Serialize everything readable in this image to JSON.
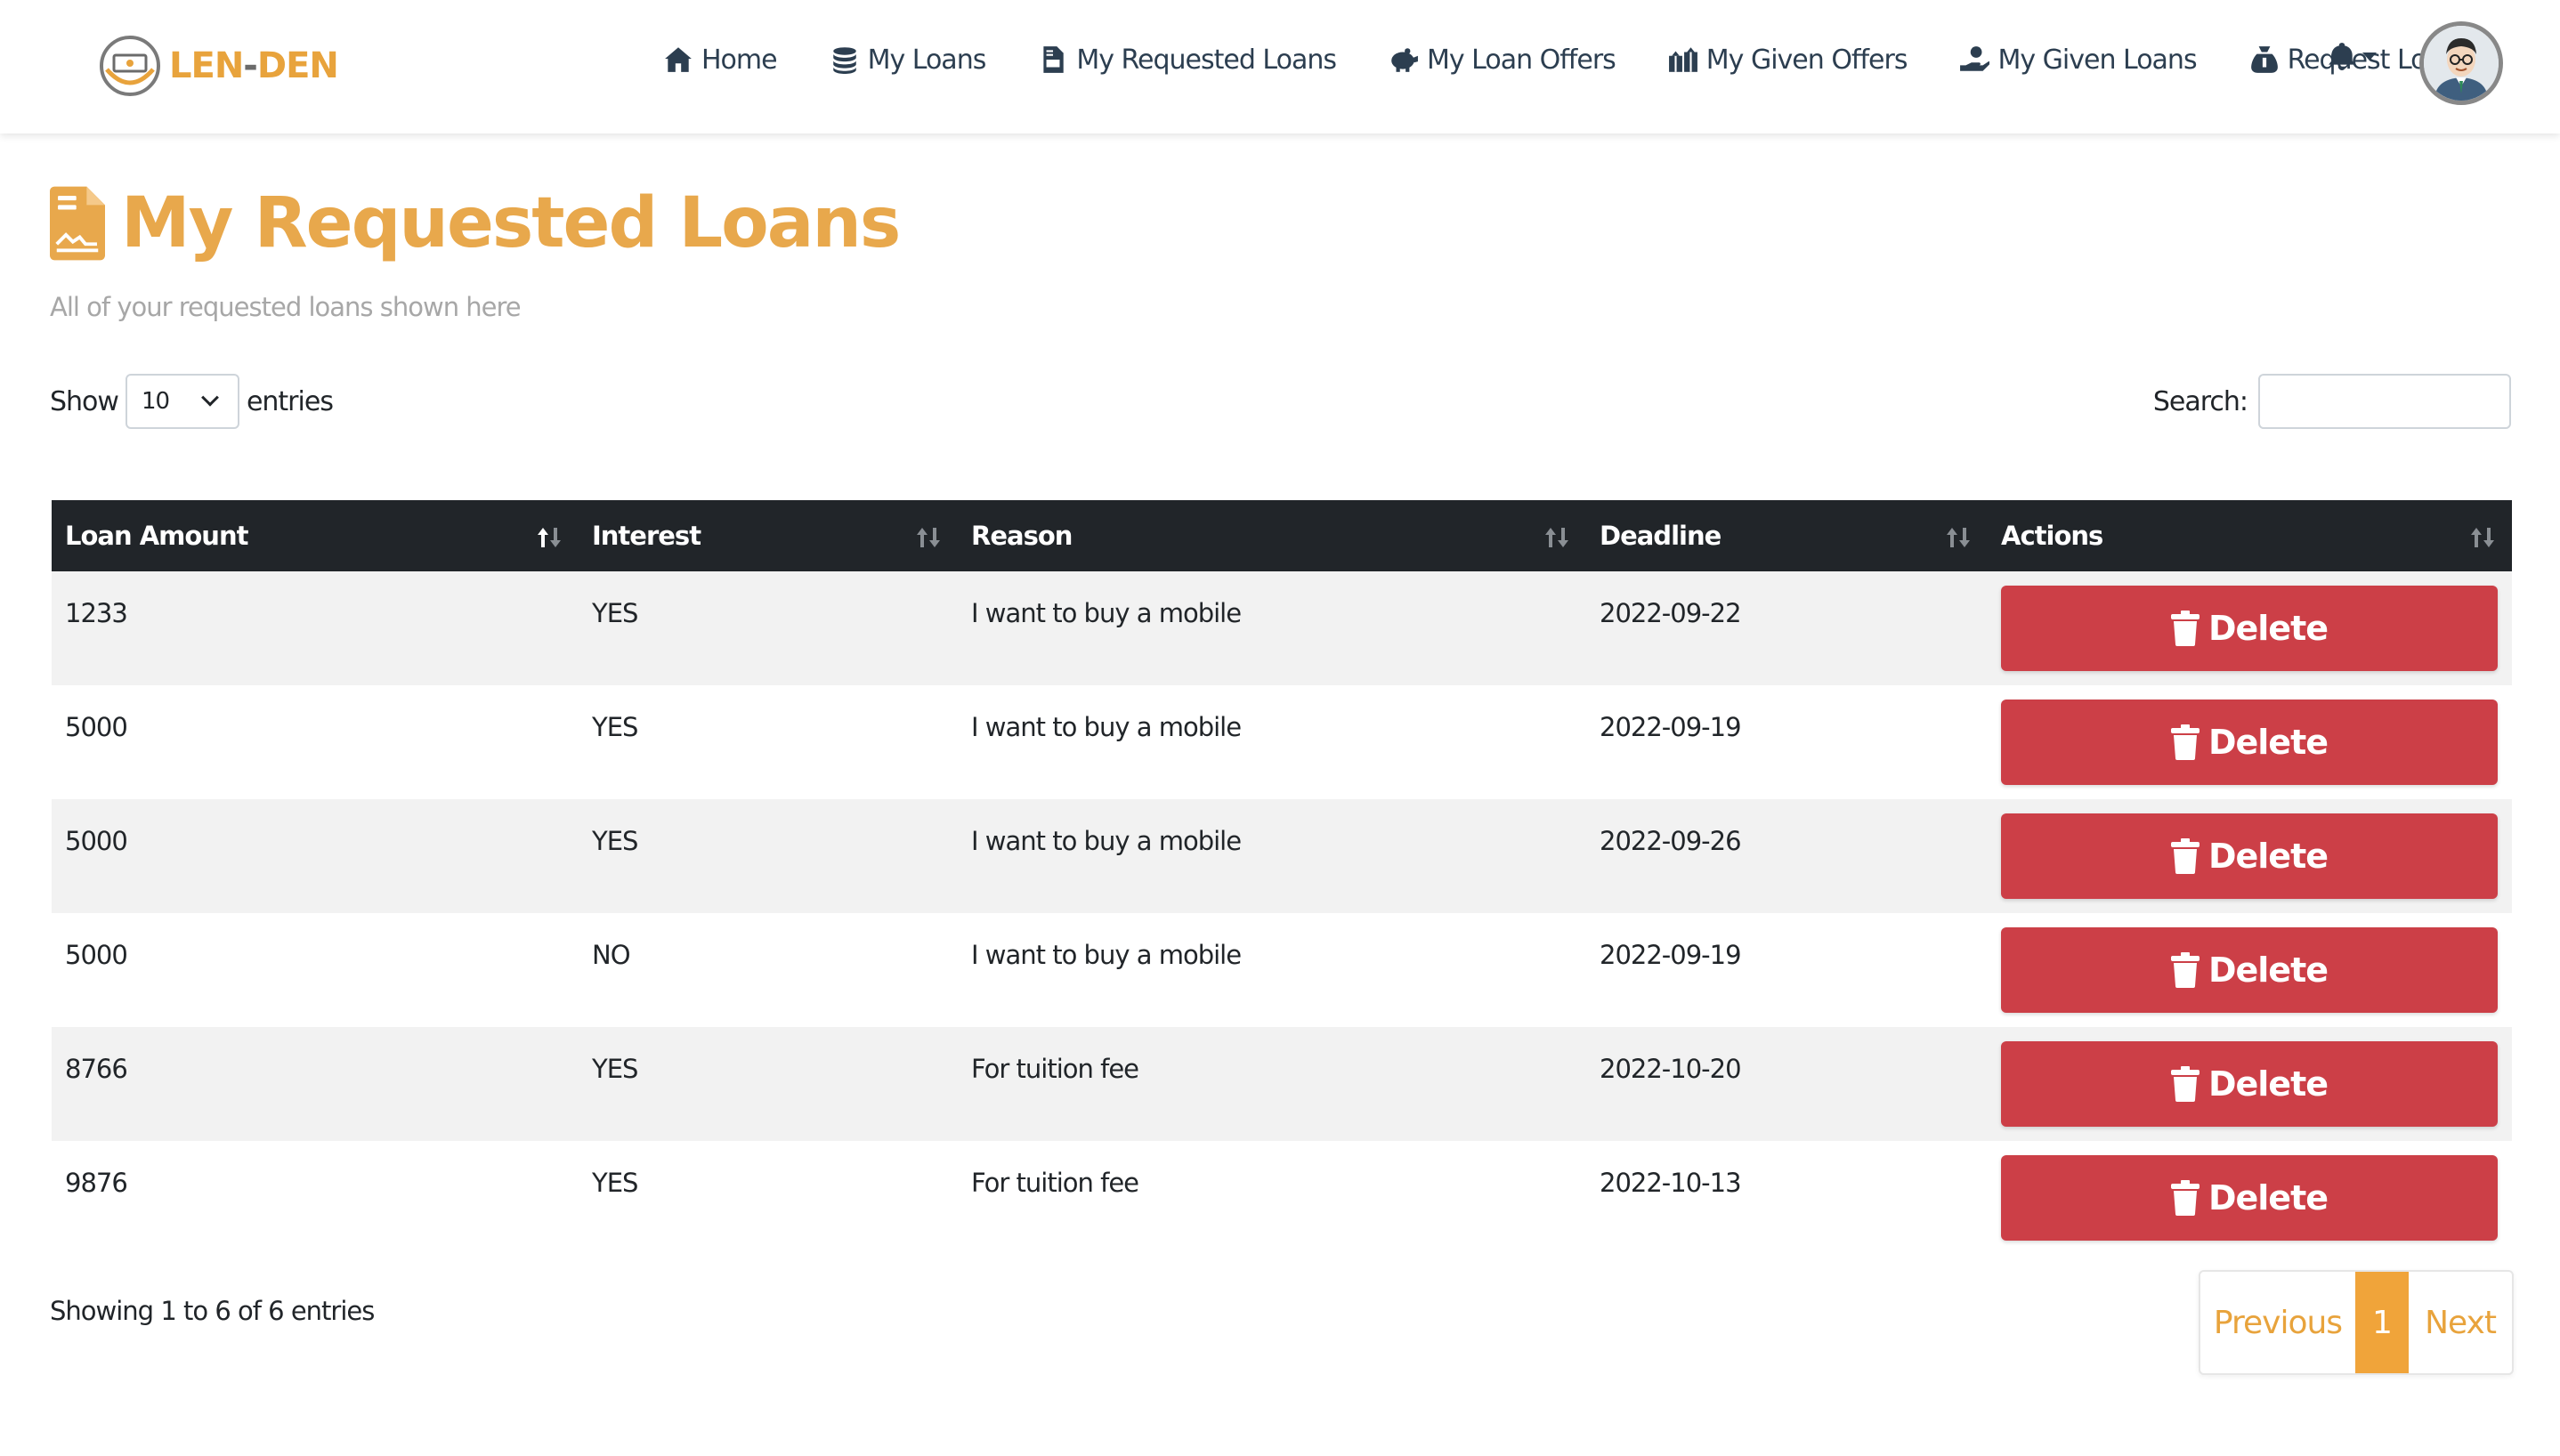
{
  "brand": {
    "name_a": "LEN",
    "name_sep": "-",
    "name_b": "DEN"
  },
  "nav": {
    "items": [
      {
        "label": "Home",
        "icon": "house-icon"
      },
      {
        "label": "My Loans",
        "icon": "coins-icon"
      },
      {
        "label": "My Requested Loans",
        "icon": "file-invoice-icon"
      },
      {
        "label": "My Loan Offers",
        "icon": "piggy-bank-icon"
      },
      {
        "label": "My Given Offers",
        "icon": "gifts-icon"
      },
      {
        "label": "My Given Loans",
        "icon": "hand-holding-dollar-icon"
      },
      {
        "label": "Request Loan",
        "icon": "money-bag-icon"
      }
    ]
  },
  "page": {
    "title": "My Requested Loans",
    "subtitle": "All of your requested loans shown here"
  },
  "controls": {
    "show_label": "Show",
    "entries_value": "10",
    "entries_label": "entries",
    "search_label": "Search:",
    "search_value": ""
  },
  "table": {
    "headers": [
      "Loan Amount",
      "Interest",
      "Reason",
      "Deadline",
      "Actions"
    ],
    "rows": [
      {
        "amount": "1233",
        "interest": "YES",
        "reason": "I want to buy a mobile",
        "deadline": "2022-09-22",
        "action": "Delete"
      },
      {
        "amount": "5000",
        "interest": "YES",
        "reason": "I want to buy a mobile",
        "deadline": "2022-09-19",
        "action": "Delete"
      },
      {
        "amount": "5000",
        "interest": "YES",
        "reason": "I want to buy a mobile",
        "deadline": "2022-09-26",
        "action": "Delete"
      },
      {
        "amount": "5000",
        "interest": "NO",
        "reason": "I want to buy a mobile",
        "deadline": "2022-09-19",
        "action": "Delete"
      },
      {
        "amount": "8766",
        "interest": "YES",
        "reason": "For tuition fee",
        "deadline": "2022-10-20",
        "action": "Delete"
      },
      {
        "amount": "9876",
        "interest": "YES",
        "reason": "For tuition fee",
        "deadline": "2022-10-13",
        "action": "Delete"
      }
    ]
  },
  "footer": {
    "info": "Showing 1 to 6 of 6 entries",
    "prev": "Previous",
    "page": "1",
    "next": "Next"
  },
  "colors": {
    "accent": "#e8a33c",
    "danger": "#cc3f47",
    "header_dark": "#212529"
  }
}
